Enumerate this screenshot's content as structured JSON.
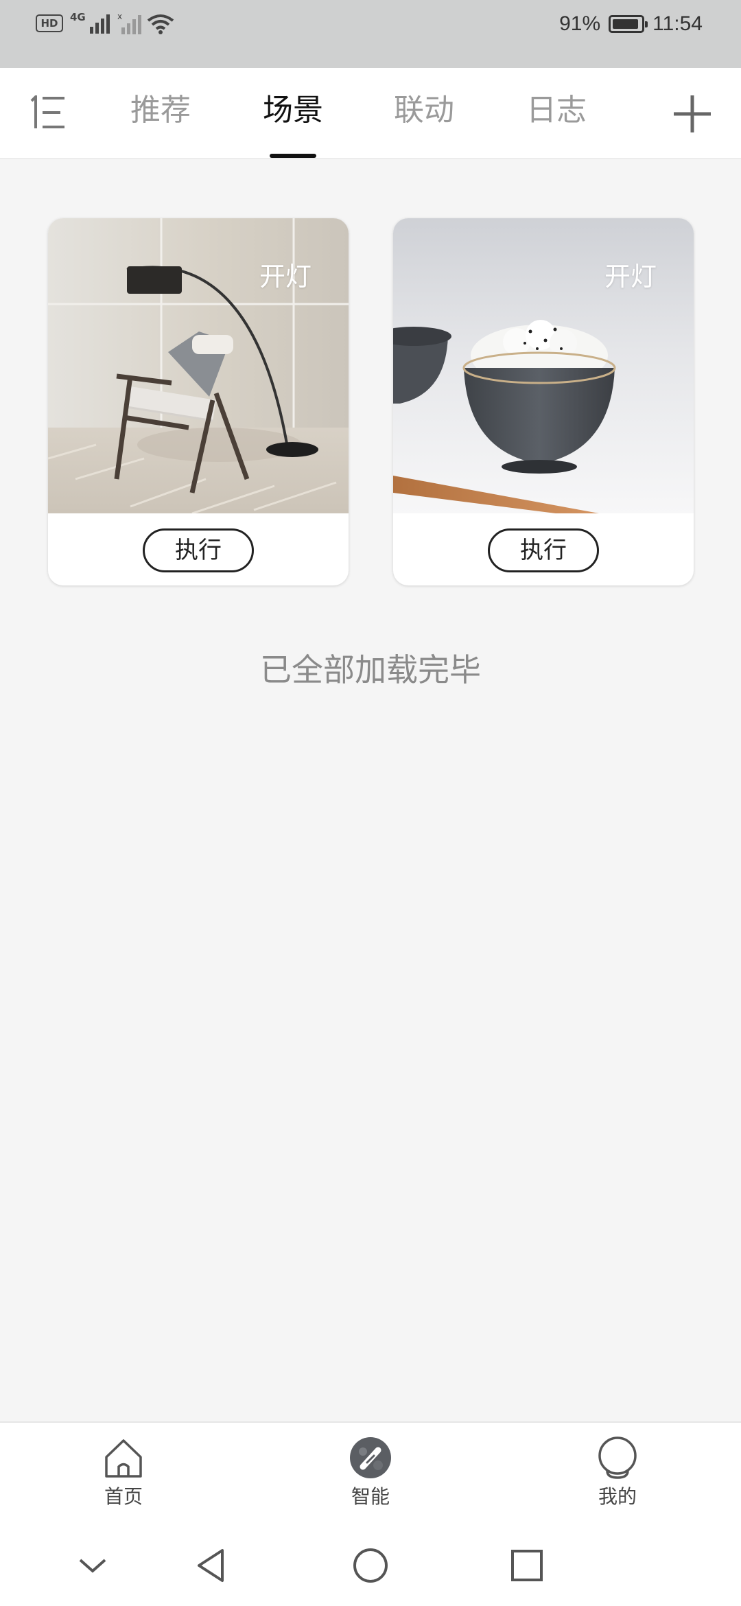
{
  "status_bar": {
    "hd": "HD",
    "network": "4G",
    "battery_text": "91%",
    "battery_level": 0.91,
    "time": "11:54"
  },
  "top_nav": {
    "tabs": [
      {
        "label": "推荐"
      },
      {
        "label": "场景"
      },
      {
        "label": "联动"
      },
      {
        "label": "日志"
      }
    ],
    "active_tab": "场景"
  },
  "scenes": [
    {
      "name": "开灯",
      "button": "执行",
      "image": "chair-and-floor-lamp"
    },
    {
      "name": "开灯",
      "button": "执行",
      "image": "rice-bowl"
    }
  ],
  "end_message": "已全部加载完毕",
  "bottom_nav": {
    "items": [
      {
        "label": "首页",
        "icon": "home-icon"
      },
      {
        "label": "智能",
        "icon": "smart-icon"
      },
      {
        "label": "我的",
        "icon": "profile-icon"
      }
    ]
  },
  "colors": {
    "status_bar_bg": "#cfd0d0",
    "page_bg": "#f5f5f5",
    "active_tab": "#111111",
    "inactive_tab": "#9a9a9a"
  }
}
